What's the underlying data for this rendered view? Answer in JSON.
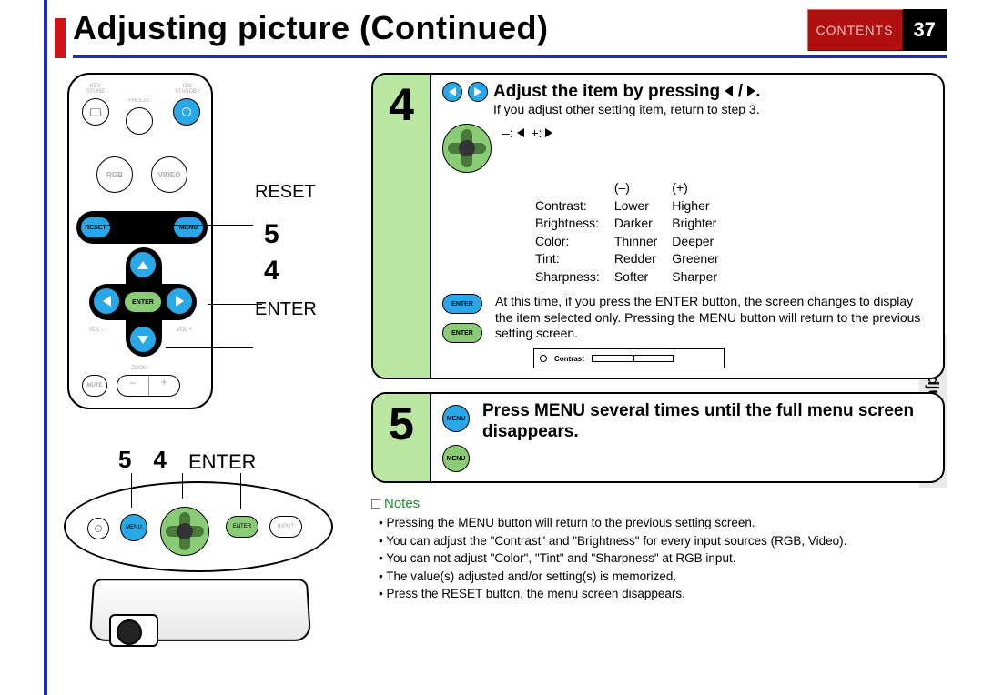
{
  "header": {
    "title": "Adjusting picture (Continued)",
    "contents_label": "CONTENTS",
    "page_number": "37"
  },
  "side_tab": "Adjustments",
  "remote": {
    "labels": {
      "keystone": "KEY STONE",
      "on_standby": "ON/ STANDBY",
      "freeze": "FREEZE",
      "rgb": "RGB",
      "video": "VIDEO",
      "reset": "RESET",
      "menu": "MENU",
      "enter": "ENTER",
      "vol_minus": "VOL –",
      "vol_plus": "VOL +",
      "zoom": "ZOOM",
      "mute": "MUTE"
    },
    "callouts": {
      "reset": "RESET",
      "five": "5",
      "four": "4",
      "enter": "ENTER"
    }
  },
  "bottom": {
    "labels": {
      "five": "5",
      "four": "4",
      "enter": "ENTER"
    },
    "panel_btn": {
      "menu": "MENU",
      "enter": "ENTER",
      "input": "INPUT"
    }
  },
  "step4": {
    "num": "4",
    "heading_prefix": "Adjust the item by pressing ",
    "heading_suffix": ".",
    "sub": "If you adjust other setting item, return to step 3.",
    "minmax": "–: ◀   +: ▶",
    "cols": {
      "minus": "(–)",
      "plus": "(+)"
    },
    "rows": [
      {
        "name": "Contrast:",
        "minus": "Lower",
        "plus": "Higher"
      },
      {
        "name": "Brightness:",
        "minus": "Darker",
        "plus": "Brighter"
      },
      {
        "name": "Color:",
        "minus": "Thinner",
        "plus": "Deeper"
      },
      {
        "name": "Tint:",
        "minus": "Redder",
        "plus": "Greener"
      },
      {
        "name": "Sharpness:",
        "minus": "Softer",
        "plus": "Sharper"
      }
    ],
    "enter_label": "ENTER",
    "note": "At this time, if you press the ENTER button, the screen changes to display the item selected only. Pressing the MENU button will return to the previous setting screen.",
    "osd_label": "Contrast"
  },
  "step5": {
    "num": "5",
    "menu_label": "MENU",
    "heading": "Press MENU several times until the full menu screen disappears."
  },
  "notes": {
    "title": "Notes",
    "items": [
      "Pressing the MENU button will return to the previous setting screen.",
      "You can adjust the \"Contrast\" and \"Brightness\" for every input sources (RGB, Video).",
      "You can not adjust \"Color\", \"Tint\" and \"Sharpness\" at RGB input.",
      "The value(s) adjusted and/or setting(s) is memorized.",
      "Press the RESET button, the menu screen disappears."
    ]
  }
}
